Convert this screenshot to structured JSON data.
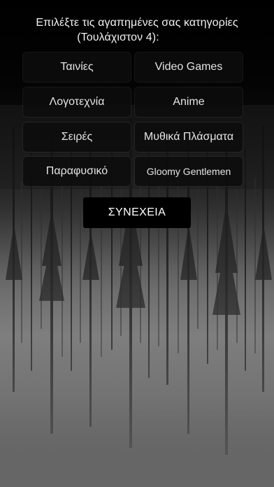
{
  "header": {
    "line1": "Επιλέξτε τις αγαπημένες σας κατηγορίες",
    "line2": "(Τουλάχιστον 4):"
  },
  "categories": [
    {
      "label": "Ταινίες"
    },
    {
      "label": "Video Games"
    },
    {
      "label": "Λογοτεχνία"
    },
    {
      "label": "Anime"
    },
    {
      "label": "Σειρές"
    },
    {
      "label": "Μυθικά Πλάσματα"
    },
    {
      "label": "Παραφυσικό"
    },
    {
      "label": "Gloomy Gentlemen"
    }
  ],
  "continue_label": "ΣΥΝΕΧΕΙΑ",
  "colors": {
    "button_bg": "#0c0c0c",
    "button_text": "#e4e4e4",
    "continue_bg": "#000000"
  }
}
